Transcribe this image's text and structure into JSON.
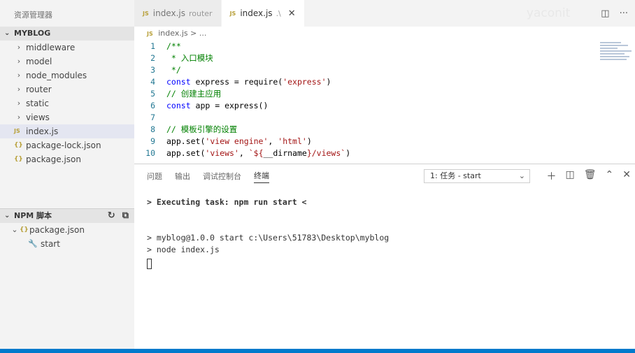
{
  "sidebar": {
    "title": "资源管理器",
    "project": "MYBLOG",
    "items": [
      {
        "label": "middleware",
        "type": "folder"
      },
      {
        "label": "model",
        "type": "folder"
      },
      {
        "label": "node_modules",
        "type": "folder"
      },
      {
        "label": "router",
        "type": "folder"
      },
      {
        "label": "static",
        "type": "folder"
      },
      {
        "label": "views",
        "type": "folder"
      },
      {
        "label": "index.js",
        "type": "js"
      },
      {
        "label": "package-lock.json",
        "type": "json"
      },
      {
        "label": "package.json",
        "type": "json"
      }
    ],
    "npm": {
      "title": "NPM 脚本",
      "file": "package.json",
      "script": "start"
    }
  },
  "tabs": [
    {
      "label": "index.js",
      "desc": "router"
    },
    {
      "label": "index.js",
      "desc": ".\\"
    }
  ],
  "watermark": "yaconit",
  "breadcrumb": {
    "file": "index.js",
    "rest": "> ..."
  },
  "code_lines": [
    {
      "n": "1",
      "parts": [
        {
          "c": "cm",
          "t": "/**"
        }
      ]
    },
    {
      "n": "2",
      "parts": [
        {
          "c": "cm",
          "t": " * 入口模块"
        }
      ]
    },
    {
      "n": "3",
      "parts": [
        {
          "c": "cm",
          "t": " */"
        }
      ]
    },
    {
      "n": "4",
      "parts": [
        {
          "c": "kw",
          "t": "const"
        },
        {
          "c": "tx",
          "t": " express = require("
        },
        {
          "c": "str",
          "t": "'express'"
        },
        {
          "c": "tx",
          "t": ")"
        }
      ]
    },
    {
      "n": "5",
      "parts": [
        {
          "c": "cm",
          "t": "// 创建主应用"
        }
      ]
    },
    {
      "n": "6",
      "parts": [
        {
          "c": "kw",
          "t": "const"
        },
        {
          "c": "tx",
          "t": " app = express()"
        }
      ]
    },
    {
      "n": "7",
      "parts": []
    },
    {
      "n": "8",
      "parts": [
        {
          "c": "cm",
          "t": "// 模板引擎的设置"
        }
      ]
    },
    {
      "n": "9",
      "parts": [
        {
          "c": "tx",
          "t": "app.set("
        },
        {
          "c": "str",
          "t": "'view engine'"
        },
        {
          "c": "tx",
          "t": ", "
        },
        {
          "c": "str",
          "t": "'html'"
        },
        {
          "c": "tx",
          "t": ")"
        }
      ]
    },
    {
      "n": "10",
      "parts": [
        {
          "c": "tx",
          "t": "app.set("
        },
        {
          "c": "str",
          "t": "'views'"
        },
        {
          "c": "tx",
          "t": ", "
        },
        {
          "c": "str",
          "t": "`${"
        },
        {
          "c": "tx",
          "t": "__dirname"
        },
        {
          "c": "str",
          "t": "}/views`"
        },
        {
          "c": "tx",
          "t": ")"
        }
      ]
    }
  ],
  "panel": {
    "tabs": [
      "问题",
      "输出",
      "调试控制台",
      "终端"
    ],
    "active_tab": 3,
    "task_select": "1: 任务 - start",
    "terminal_lines": [
      "> Executing task: npm run start <",
      "",
      "",
      "> myblog@1.0.0 start c:\\Users\\51783\\Desktop\\myblog",
      "> node index.js"
    ]
  },
  "icons": {
    "folder_arrow": "chevron-right-icon",
    "js_badge": "JS",
    "json_badge": "{}"
  },
  "colors": {
    "keyword": "#0000ff",
    "string": "#a31515",
    "comment": "#008000",
    "line_number": "#237893",
    "statusbar": "#007acc"
  }
}
